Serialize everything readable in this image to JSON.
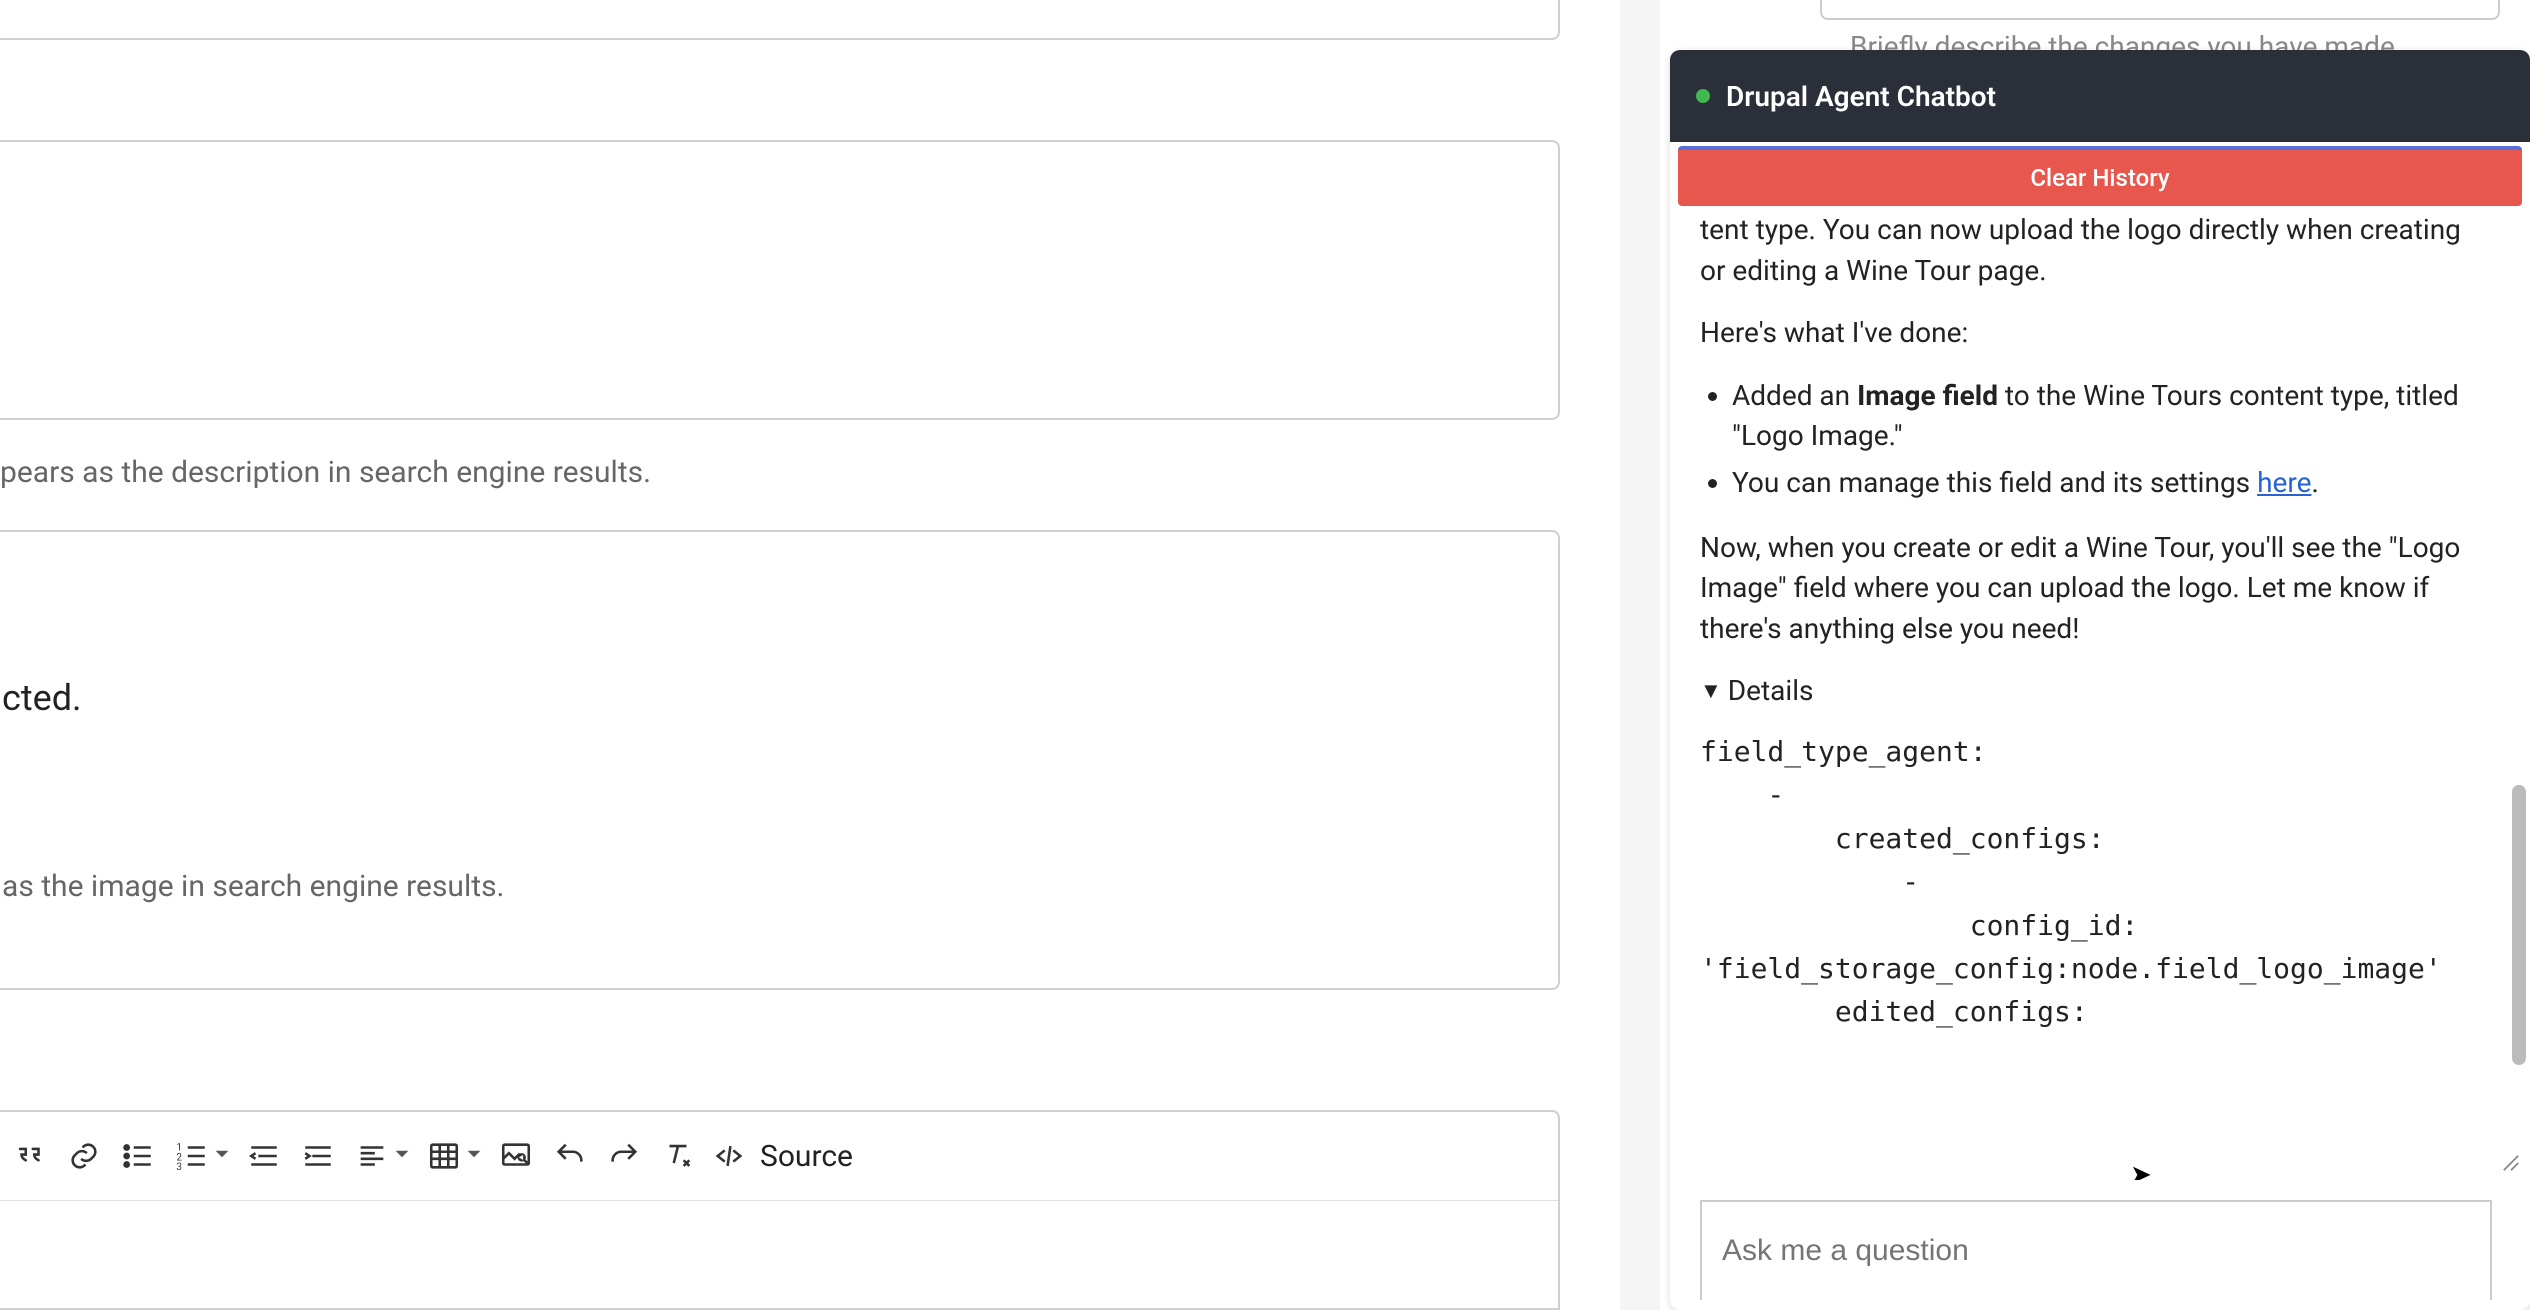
{
  "main": {
    "help_desc": "pears as the description in search engine results.",
    "cted_line": "cted.",
    "help_image": "as the image in search engine results.",
    "toolbar": {
      "source_label": "Source"
    }
  },
  "behind_hint": "Briefly describe the changes you have made",
  "chat": {
    "title": "Drupal Agent Chatbot",
    "clear_label": "Clear History",
    "message": {
      "intro_cutoff": "tent type. You can now upload the logo directly when creating or editing a Wine Tour page.",
      "done_heading": "Here's what I've done:",
      "bullet1_pre": "Added an ",
      "bullet1_strong": "Image field",
      "bullet1_post": " to the Wine Tours content type, titled \"Logo Image.\"",
      "bullet2_pre": "You can manage this field and its settings ",
      "bullet2_link": "here",
      "bullet2_post": ".",
      "outro": "Now, when you create or edit a Wine Tour, you'll see the \"Logo Image\" field where you can upload the logo. Let me know if there's anything else you need!",
      "details_label": "Details",
      "code": "field_type_agent:\n    -\n        created_configs:\n            -\n                config_id:\n'field_storage_config:node.field_logo_image'\n        edited_configs:"
    },
    "input_placeholder": "Ask me a question"
  },
  "chart_data": null
}
